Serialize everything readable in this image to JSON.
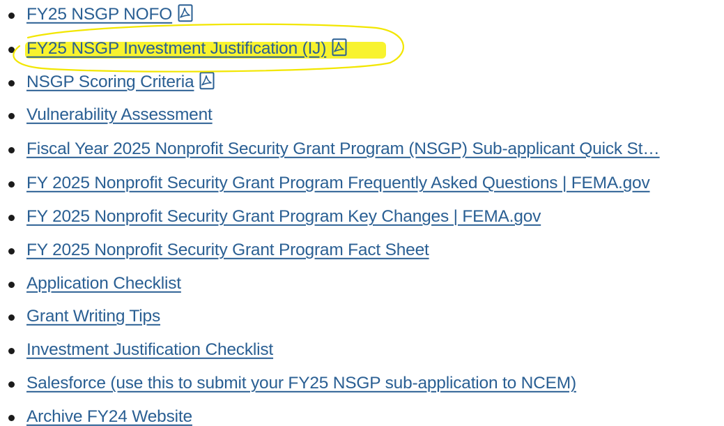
{
  "links": [
    {
      "label": "FY25 NSGP NOFO",
      "has_pdf": true
    },
    {
      "label": "FY25 NSGP Investment Justification (IJ)",
      "has_pdf": true
    },
    {
      "label": "NSGP Scoring Criteria",
      "has_pdf": true
    },
    {
      "label": "Vulnerability Assessment",
      "has_pdf": false
    },
    {
      "label": "Fiscal Year 2025 Nonprofit Security Grant Program (NSGP) Sub-applicant Quick St…",
      "has_pdf": false
    },
    {
      "label": "FY 2025 Nonprofit Security Grant Program Frequently Asked Questions | FEMA.gov",
      "has_pdf": false
    },
    {
      "label": "FY 2025 Nonprofit Security Grant Program Key Changes | FEMA.gov",
      "has_pdf": false
    },
    {
      "label": "FY 2025 Nonprofit Security Grant Program Fact Sheet",
      "has_pdf": false
    },
    {
      "label": "Application Checklist",
      "has_pdf": false
    },
    {
      "label": "Grant Writing Tips",
      "has_pdf": false
    },
    {
      "label": "Investment Justification Checklist",
      "has_pdf": false
    },
    {
      "label": "Salesforce (use this to submit your FY25 NSGP sub-application to NCEM)",
      "has_pdf": false
    },
    {
      "label": "Archive FY24 Website",
      "has_pdf": false
    }
  ],
  "icons": {
    "pdf": "pdf-file-icon"
  },
  "colors": {
    "link": "#2a5f93",
    "bullet": "#1b1b1b",
    "highlight": "#f7f21c",
    "annotation": "#f2e600"
  }
}
